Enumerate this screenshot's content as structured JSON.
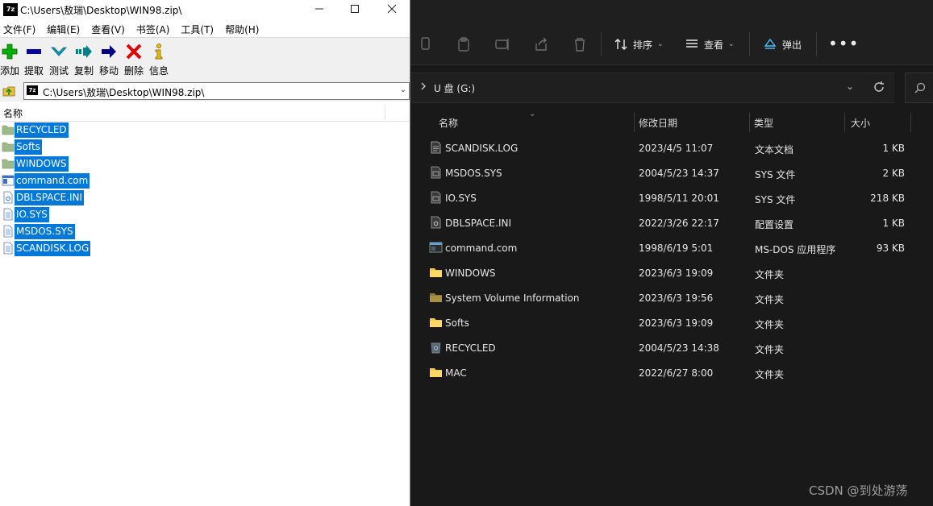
{
  "sevenzip": {
    "title": "C:\\Users\\敖瑞\\Desktop\\WIN98.zip\\",
    "logo_text": "7z",
    "menu": [
      "文件(F)",
      "编辑(E)",
      "查看(V)",
      "书签(A)",
      "工具(T)",
      "帮助(H)"
    ],
    "toolbar": [
      {
        "label": "添加",
        "icon": "add-icon",
        "color": "#00b000"
      },
      {
        "label": "提取",
        "icon": "extract-icon",
        "color": "#0000a0"
      },
      {
        "label": "测试",
        "icon": "test-icon",
        "color": "#00a0c0"
      },
      {
        "label": "复制",
        "icon": "copy-icon",
        "color": "#00808a"
      },
      {
        "label": "移动",
        "icon": "move-icon",
        "color": "#000080"
      },
      {
        "label": "删除",
        "icon": "delete-icon",
        "color": "#e00000"
      },
      {
        "label": "信息",
        "icon": "info-icon",
        "color": "#c8a000"
      }
    ],
    "address": "C:\\Users\\敖瑞\\Desktop\\WIN98.zip\\",
    "column_name": "名称",
    "files": [
      {
        "name": "RECYCLED",
        "icon": "folder-icon"
      },
      {
        "name": "Softs",
        "icon": "folder-icon"
      },
      {
        "name": "WINDOWS",
        "icon": "folder-icon"
      },
      {
        "name": "command.com",
        "icon": "app-icon"
      },
      {
        "name": "DBLSPACE.INI",
        "icon": "settings-file-icon"
      },
      {
        "name": "IO.SYS",
        "icon": "file-icon"
      },
      {
        "name": "MSDOS.SYS",
        "icon": "file-icon"
      },
      {
        "name": "SCANDISK.LOG",
        "icon": "file-icon"
      }
    ],
    "selection_color": "#0078d7"
  },
  "explorer": {
    "toolbar": {
      "sort_label": "排序",
      "view_label": "查看",
      "eject_label": "弹出",
      "more_label": "•••"
    },
    "breadcrumb": "U 盘 (G:)",
    "columns": {
      "name": "名称",
      "date": "修改日期",
      "type": "类型",
      "size": "大小"
    },
    "files": [
      {
        "name": "SCANDISK.LOG",
        "date": "2023/4/5 11:07",
        "type": "文本文档",
        "size": "1 KB",
        "icon": "text-file-icon"
      },
      {
        "name": "MSDOS.SYS",
        "date": "2004/5/23 14:37",
        "type": "SYS 文件",
        "size": "2 KB",
        "icon": "system-file-icon"
      },
      {
        "name": "IO.SYS",
        "date": "1998/5/11 20:01",
        "type": "SYS 文件",
        "size": "218 KB",
        "icon": "system-file-icon"
      },
      {
        "name": "DBLSPACE.INI",
        "date": "2022/3/26 22:17",
        "type": "配置设置",
        "size": "1 KB",
        "icon": "settings-file-icon"
      },
      {
        "name": "command.com",
        "date": "1998/6/19 5:01",
        "type": "MS-DOS 应用程序",
        "size": "93 KB",
        "icon": "app-icon"
      },
      {
        "name": "WINDOWS",
        "date": "2023/6/3 19:09",
        "type": "文件夹",
        "size": "",
        "icon": "folder-icon"
      },
      {
        "name": "System Volume Information",
        "date": "2023/6/3 19:56",
        "type": "文件夹",
        "size": "",
        "icon": "locked-folder-icon"
      },
      {
        "name": "Softs",
        "date": "2023/6/3 19:09",
        "type": "文件夹",
        "size": "",
        "icon": "folder-icon"
      },
      {
        "name": "RECYCLED",
        "date": "2004/5/23 14:38",
        "type": "文件夹",
        "size": "",
        "icon": "recycle-bin-icon"
      },
      {
        "name": "MAC",
        "date": "2022/6/27 8:00",
        "type": "文件夹",
        "size": "",
        "icon": "folder-icon"
      }
    ],
    "folder_color": "#f2c94c",
    "accent_color": "#4cc2ff"
  },
  "watermark": "CSDN @到处游荡"
}
